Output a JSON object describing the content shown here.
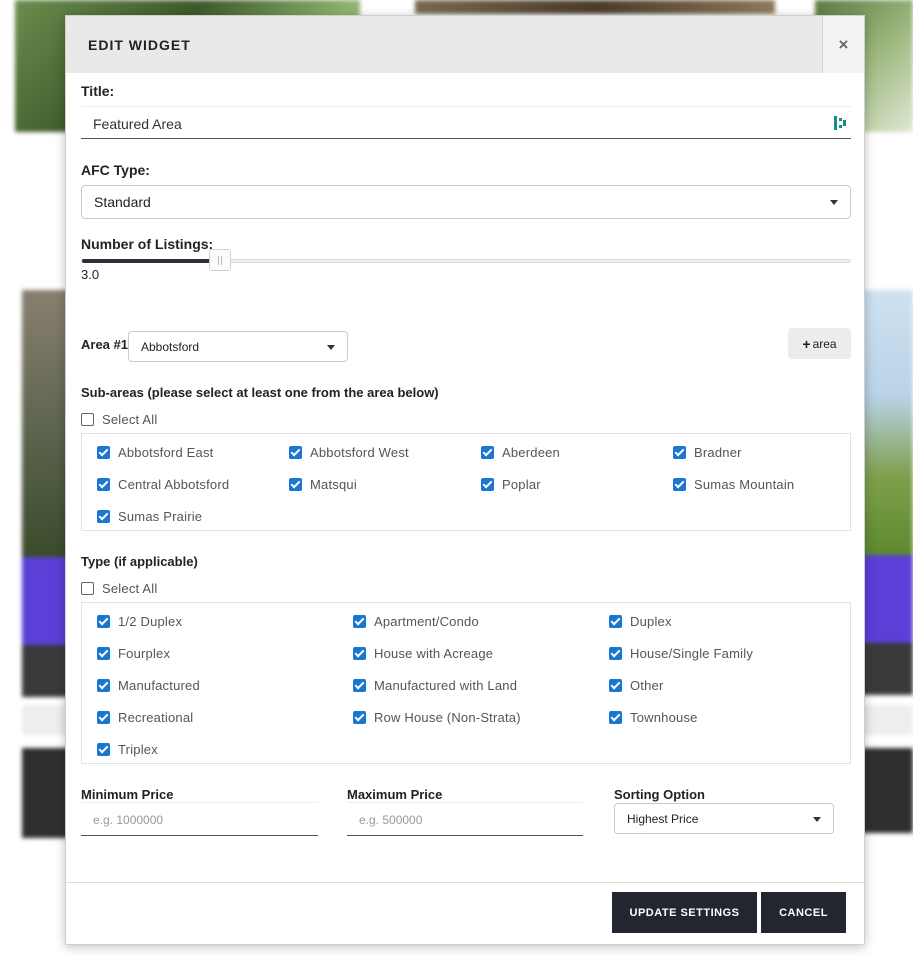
{
  "modal": {
    "title": "EDIT WIDGET",
    "close_glyph": "×"
  },
  "form": {
    "title_label": "Title:",
    "title_value": "Featured Area",
    "afc_type_label": "AFC Type:",
    "afc_type_value": "Standard",
    "listings_label": "Number of Listings:",
    "listings_value": "3.0",
    "listings_fraction": 0.18,
    "area_label": "Area #1",
    "area_value": "Abbotsford",
    "add_area_label": "area",
    "add_area_icon": "+"
  },
  "subareas": {
    "heading": "Sub-areas (please select at least one from the area below)",
    "select_all_label": "Select All",
    "select_all_checked": false,
    "items": [
      {
        "label": "Abbotsford East",
        "checked": true
      },
      {
        "label": "Abbotsford West",
        "checked": true
      },
      {
        "label": "Aberdeen",
        "checked": true
      },
      {
        "label": "Bradner",
        "checked": true
      },
      {
        "label": "Central Abbotsford",
        "checked": true
      },
      {
        "label": "Matsqui",
        "checked": true
      },
      {
        "label": "Poplar",
        "checked": true
      },
      {
        "label": "Sumas Mountain",
        "checked": true
      },
      {
        "label": "Sumas Prairie",
        "checked": true
      }
    ]
  },
  "types": {
    "heading": "Type (if applicable)",
    "select_all_label": "Select All",
    "select_all_checked": false,
    "items": [
      {
        "label": "1/2 Duplex",
        "checked": true
      },
      {
        "label": "Apartment/Condo",
        "checked": true
      },
      {
        "label": "Duplex",
        "checked": true
      },
      {
        "label": "Fourplex",
        "checked": true
      },
      {
        "label": "House with Acreage",
        "checked": true
      },
      {
        "label": "House/Single Family",
        "checked": true
      },
      {
        "label": "Manufactured",
        "checked": true
      },
      {
        "label": "Manufactured with Land",
        "checked": true
      },
      {
        "label": "Other",
        "checked": true
      },
      {
        "label": "Recreational",
        "checked": true
      },
      {
        "label": "Row House (Non-Strata)",
        "checked": true
      },
      {
        "label": "Townhouse",
        "checked": true
      },
      {
        "label": "Triplex",
        "checked": true
      }
    ]
  },
  "pricing": {
    "min_label": "Minimum Price",
    "min_placeholder": "e.g. 1000000",
    "max_label": "Maximum Price",
    "max_placeholder": "e.g. 500000",
    "sort_label": "Sorting Option",
    "sort_value": "Highest Price"
  },
  "footer": {
    "update_label": "UPDATE SETTINGS",
    "cancel_label": "CANCEL"
  },
  "colors": {
    "checkbox_accent": "#1976d2",
    "button_dark": "#22262f"
  }
}
